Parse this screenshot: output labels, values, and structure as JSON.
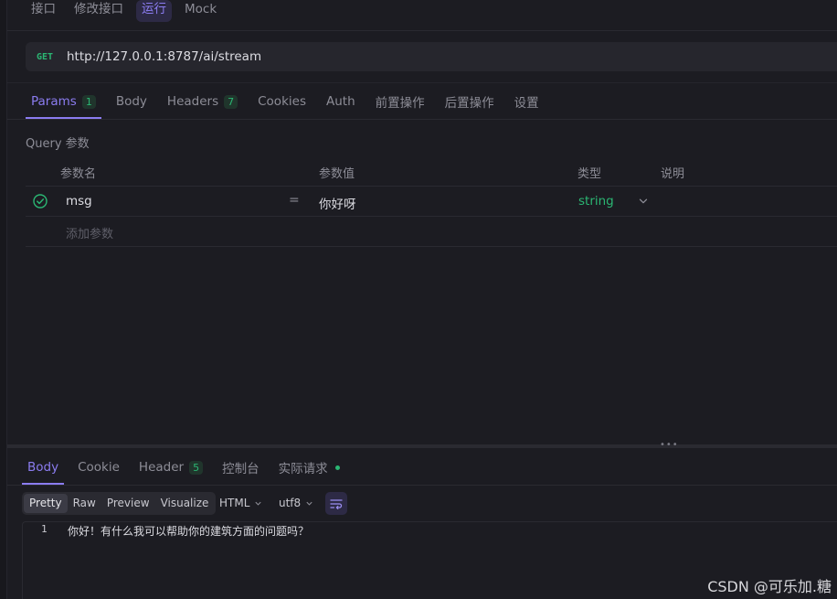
{
  "top_tabs": [
    {
      "label": "接口"
    },
    {
      "label": "修改接口"
    },
    {
      "label": "运行",
      "active": true
    },
    {
      "label": "Mock"
    }
  ],
  "request": {
    "method": "GET",
    "url": "http://127.0.0.1:8787/ai/stream"
  },
  "param_tabs": [
    {
      "label": "Params",
      "badge": "1",
      "active": true
    },
    {
      "label": "Body"
    },
    {
      "label": "Headers",
      "badge": "7"
    },
    {
      "label": "Cookies"
    },
    {
      "label": "Auth"
    },
    {
      "label": "前置操作"
    },
    {
      "label": "后置操作"
    },
    {
      "label": "设置"
    }
  ],
  "query": {
    "title": "Query 参数",
    "headers": {
      "name": "参数名",
      "value": "参数值",
      "type": "类型",
      "desc": "说明"
    },
    "rows": [
      {
        "enabled": true,
        "name": "msg",
        "eq": "=",
        "value": "你好呀",
        "type": "string",
        "desc": ""
      }
    ],
    "add_placeholder": "添加参数"
  },
  "response_tabs": [
    {
      "label": "Body",
      "active": true
    },
    {
      "label": "Cookie"
    },
    {
      "label": "Header",
      "badge": "5"
    },
    {
      "label": "控制台"
    },
    {
      "label": "实际请求",
      "dot": true
    }
  ],
  "view_modes": [
    {
      "label": "Pretty",
      "active": true
    },
    {
      "label": "Raw"
    },
    {
      "label": "Preview"
    },
    {
      "label": "Visualize"
    }
  ],
  "format_select": "HTML",
  "encoding_select": "utf8",
  "response_body": {
    "line_number": "1",
    "text": "你好！有什么我可以帮助你的建筑方面的问题吗？"
  },
  "watermark": "CSDN @可乐加.糖",
  "colors": {
    "accent": "#8b7cf0",
    "success": "#2bb673",
    "background": "#1c1c22"
  }
}
